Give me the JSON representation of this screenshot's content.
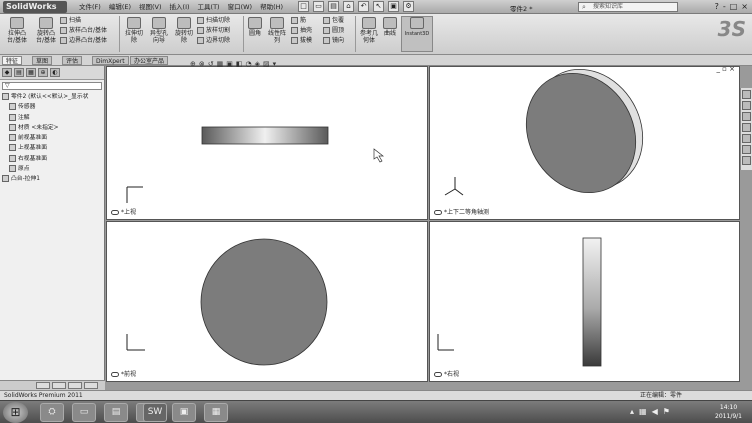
{
  "app": {
    "logo": "SolidWorks",
    "document_title": "零件2 *",
    "search_placeholder": "搜索知识库",
    "window_controls": [
      "?",
      "-",
      "□",
      "×"
    ]
  },
  "menu": [
    "文件(F)",
    "编辑(E)",
    "视图(V)",
    "插入(I)",
    "工具(T)",
    "窗口(W)",
    "帮助(H)"
  ],
  "quick_access": [
    "□",
    "▭",
    "▤",
    "⌂",
    "↶",
    "↖",
    "▣",
    "⚙"
  ],
  "ribbon": {
    "big_buttons": [
      {
        "label": "拉伸凸\n台/基体"
      },
      {
        "label": "旋转凸\n台/基体"
      },
      {
        "label": "拉伸切\n除"
      },
      {
        "label": "异型孔\n向导"
      },
      {
        "label": "旋转切\n除"
      },
      {
        "label": "圆角"
      },
      {
        "label": "线性阵\n列"
      },
      {
        "label": "参考几\n何体"
      },
      {
        "label": "曲线"
      },
      {
        "label": "Instant3D"
      }
    ],
    "small_buttons": [
      "扫描",
      "放样凸台/基体",
      "边界凸台/基体",
      "扫描切除",
      "放样切割",
      "边界切除",
      "筋",
      "抽壳",
      "拔模",
      "包覆",
      "圆顶",
      "镜向"
    ]
  },
  "command_tabs": [
    "特征",
    "草图",
    "评估",
    "DimXpert",
    "办公室产品"
  ],
  "tree": {
    "filter_icon": "filter-icon",
    "items": [
      {
        "label": "零件2 (默认<<默认>_显示状"
      },
      {
        "label": "传感器"
      },
      {
        "label": "注解"
      },
      {
        "label": "材质 <未指定>"
      },
      {
        "label": "前视基准面"
      },
      {
        "label": "上视基准面"
      },
      {
        "label": "右视基准面"
      },
      {
        "label": "原点"
      },
      {
        "label": "凸台-拉伸1"
      }
    ]
  },
  "viewports": {
    "top_left": {
      "label": "*上视"
    },
    "top_right": {
      "label": "*上下二等角轴测"
    },
    "bottom_left": {
      "label": "*前视"
    },
    "bottom_right": {
      "label": "*右视"
    }
  },
  "status": {
    "left": "SolidWorks Premium 2011",
    "right": "正在编辑：零件"
  },
  "taskbar": {
    "start_icon": "windows-start-icon",
    "items": [
      "⛭",
      "▭",
      "▤",
      "◆",
      "SW",
      "▣",
      "▦"
    ],
    "time": "14:10",
    "date": "2011/9/1"
  },
  "colors": {
    "part_fill": "#7c7c7c",
    "viewport_bg": "#ffffff",
    "ribbon_bg": "#d9d9d9"
  }
}
